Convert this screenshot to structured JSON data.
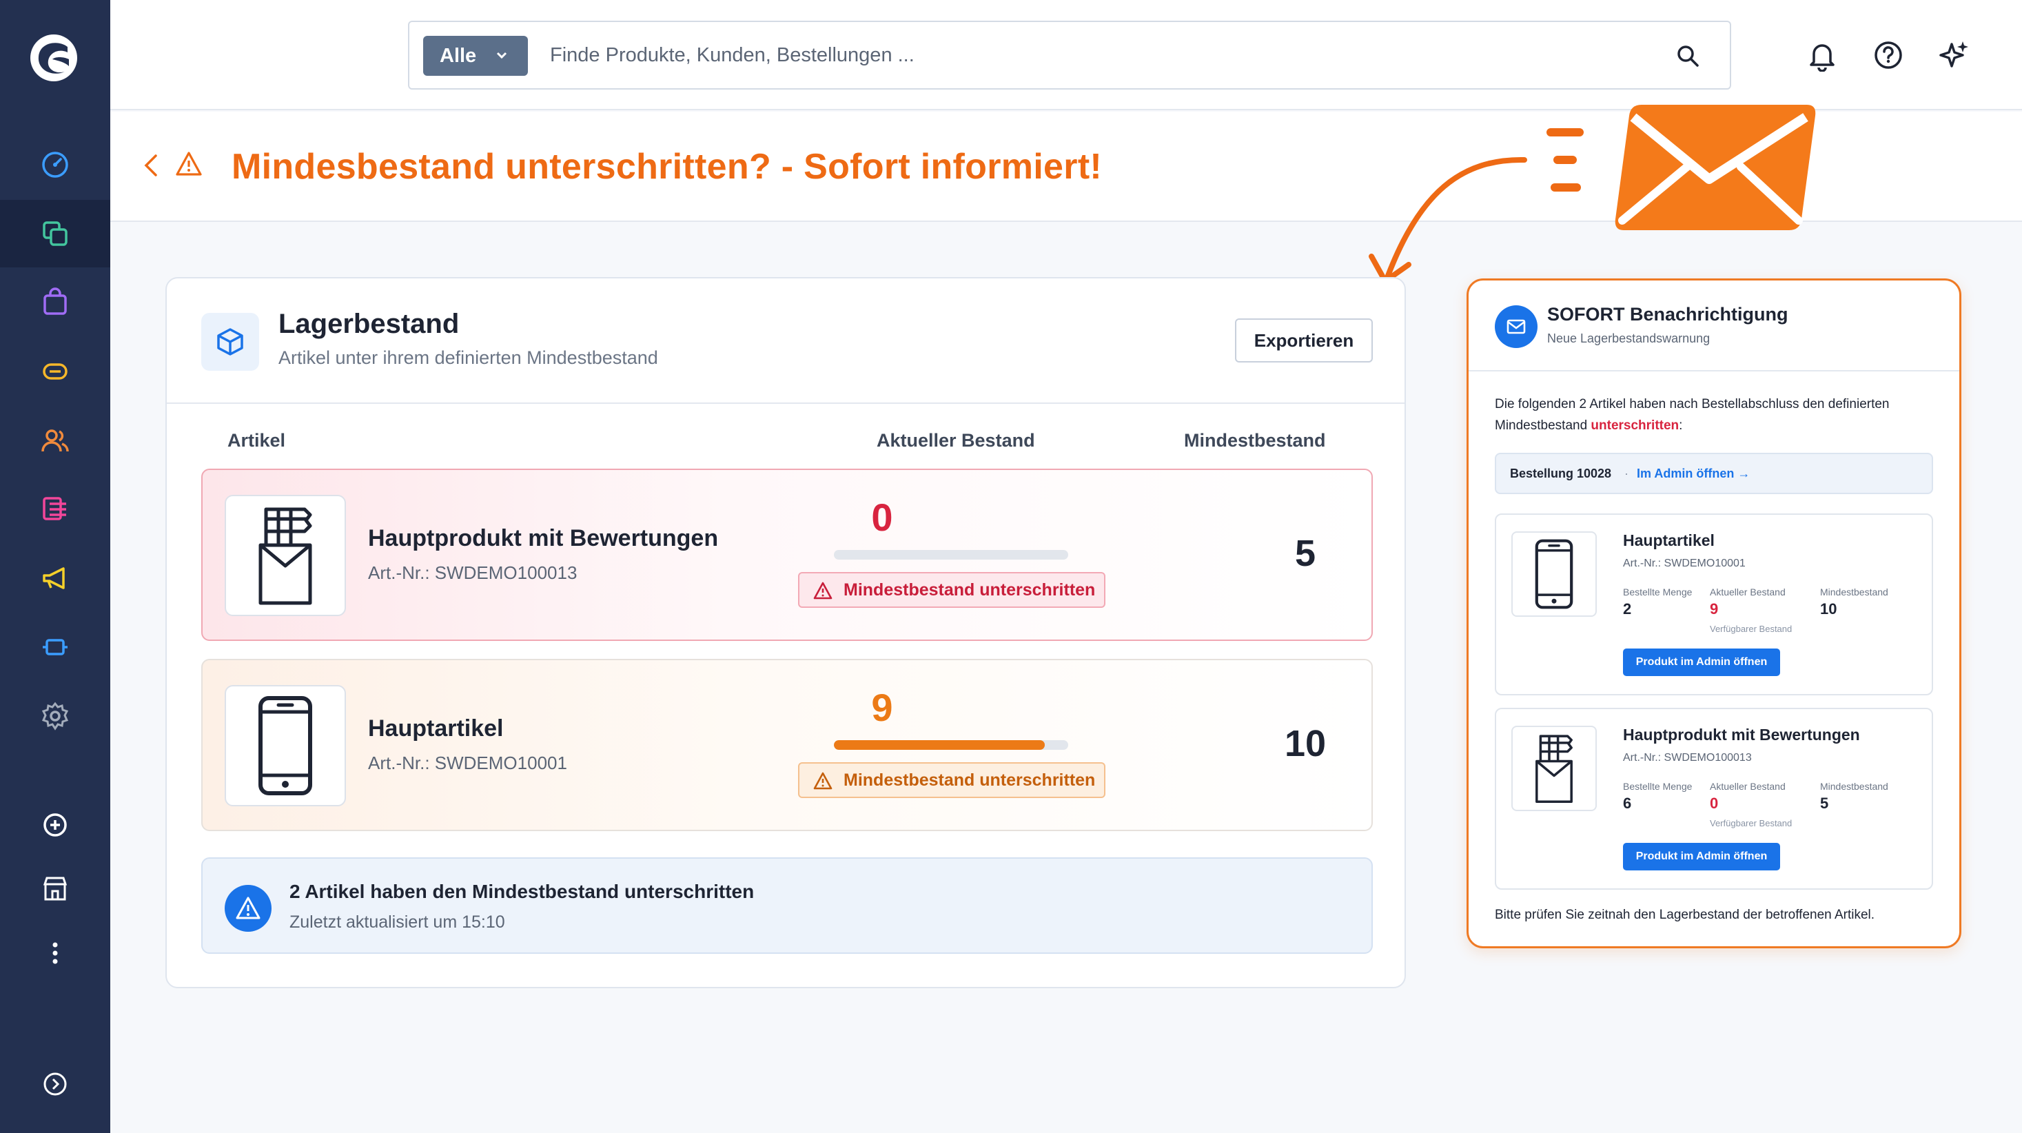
{
  "sidebar": {
    "logo": "shopware-logo",
    "items": [
      {
        "icon": "dashboard-icon",
        "color": "#3b9dff"
      },
      {
        "icon": "catalog-icon",
        "color": "#43c59e",
        "active": true
      },
      {
        "icon": "orders-icon",
        "color": "#a06cf5"
      },
      {
        "icon": "customers-payment-icon",
        "color": "#f6b72a"
      },
      {
        "icon": "customers-icon",
        "color": "#f08a3c"
      },
      {
        "icon": "content-icon",
        "color": "#f2469a"
      },
      {
        "icon": "marketing-icon",
        "color": "#f5d02a"
      },
      {
        "icon": "extensions-icon",
        "color": "#3b9dff"
      },
      {
        "icon": "settings-icon",
        "color": "#a3acbb"
      },
      {
        "icon": "add-sales-channel-icon",
        "color": "#ffffff"
      },
      {
        "icon": "storefront-icon",
        "color": "#ffffff"
      },
      {
        "icon": "more-icon",
        "color": "#ffffff"
      },
      {
        "icon": "collapse-icon",
        "color": "#ffffff"
      }
    ]
  },
  "topbar": {
    "filter_label": "Alle",
    "search_placeholder": "Finde Produkte, Kunden, Bestellungen ..."
  },
  "page": {
    "title": "Mindesbestand unterschritten? - Sofort informiert!"
  },
  "card": {
    "title": "Lagerbestand",
    "subtitle": "Artikel unter ihrem definierten Mindestbestand",
    "export_label": "Exportieren",
    "col_article": "Artikel",
    "col_current": "Aktueller Bestand",
    "col_min": "Mindestbestand",
    "rows": [
      {
        "name": "Hauptprodukt mit Bewertungen",
        "sku": "Art.-Nr.: SWDEMO100013",
        "current": "0",
        "current_fraction": 0.0,
        "badge": "Mindestbestand unterschritten",
        "min": "5",
        "status_color": "#d8243f"
      },
      {
        "name": "Hauptartikel",
        "sku": "Art.-Nr.: SWDEMO10001",
        "current": "9",
        "current_fraction": 0.9,
        "badge": "Mindestbestand unterschritten",
        "min": "10",
        "status_color": "#ec7a16"
      }
    ],
    "info_title": "2 Artikel haben den Mindestbestand unterschritten",
    "info_sub": "Zuletzt aktualisiert um 15:10"
  },
  "email": {
    "title": "SOFORT Benachrichtigung",
    "subtitle": "Neue Lagerbestandswarnung",
    "intro_pre": "Die folgenden 2 Artikel haben nach Bestellabschluss den definierten Mindestbestand ",
    "intro_highlight": "unterschritten",
    "intro_post": ":",
    "order_label": "Bestellung 10028",
    "order_sep": "·",
    "order_link": "Im Admin öffnen →",
    "items": [
      {
        "name": "Hauptartikel",
        "sku": "Art.-Nr.: SWDEMO10001",
        "ordered_label": "Bestellte Menge",
        "ordered": "2",
        "current_label": "Aktueller Bestand",
        "current": "9",
        "available_label": "Verfügbarer Bestand",
        "min_label": "Mindestbestand",
        "min": "10",
        "button": "Produkt im Admin öffnen"
      },
      {
        "name": "Hauptprodukt mit Bewertungen",
        "sku": "Art.-Nr.: SWDEMO100013",
        "ordered_label": "Bestellte Menge",
        "ordered": "6",
        "current_label": "Aktueller Bestand",
        "current": "0",
        "available_label": "Verfügbarer Bestand",
        "min_label": "Mindestbestand",
        "min": "5",
        "button": "Produkt im Admin öffnen"
      }
    ],
    "footer": "Bitte prüfen Sie zeitnah den Lagerbestand der betroffenen Artikel."
  },
  "colors": {
    "accent": "#ee6a14",
    "danger": "#d8243f",
    "primary": "#1a73e8",
    "sidebar": "#233050"
  }
}
